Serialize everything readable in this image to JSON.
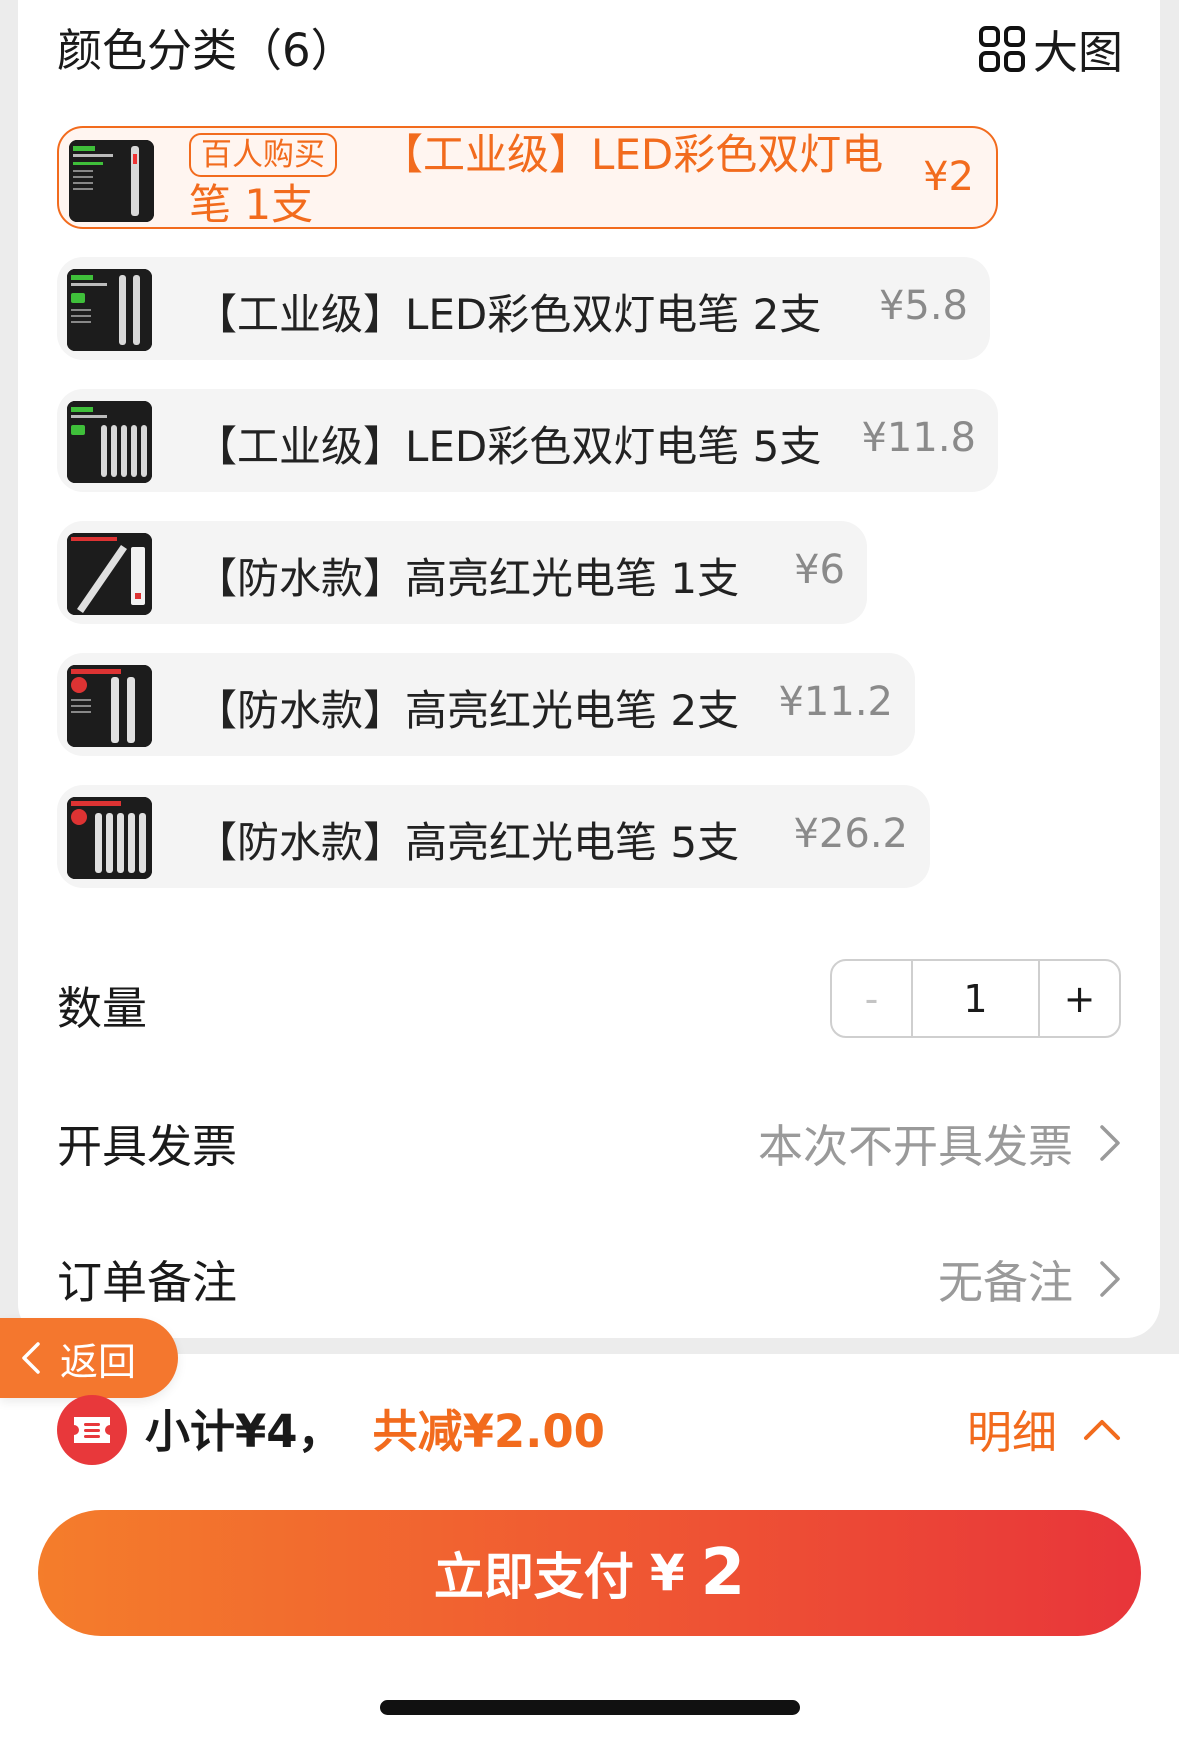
{
  "header": {
    "title": "颜色分类（6）",
    "big_view_label": "大图"
  },
  "options": [
    {
      "badge": "百人购买",
      "label": "【工业级】LED彩色双灯电笔 1支",
      "price": "¥2",
      "selected": true
    },
    {
      "label": "【工业级】LED彩色双灯电笔 2支",
      "price": "¥5.8"
    },
    {
      "label": "【工业级】LED彩色双灯电笔 5支",
      "price": "¥11.8"
    },
    {
      "label": "【防水款】高亮红光电笔 1支",
      "price": "¥6"
    },
    {
      "label": "【防水款】高亮红光电笔 2支",
      "price": "¥11.2"
    },
    {
      "label": "【防水款】高亮红光电笔 5支",
      "price": "¥26.2"
    }
  ],
  "quantity": {
    "label": "数量",
    "minus": "-",
    "value": "1",
    "plus": "+"
  },
  "invoice": {
    "label": "开具发票",
    "value": "本次不开具发票"
  },
  "remark": {
    "label": "订单备注",
    "value": "无备注"
  },
  "back_label": "返回",
  "summary": {
    "subtotal": "小计¥4，",
    "reduction": "共减¥2.00",
    "detail_label": "明细"
  },
  "pay": {
    "label": "立即支付",
    "currency": "¥",
    "amount": "2"
  },
  "colors": {
    "accent": "#f26b1d",
    "pay_start": "#f47d2b",
    "pay_end": "#e8353a"
  }
}
